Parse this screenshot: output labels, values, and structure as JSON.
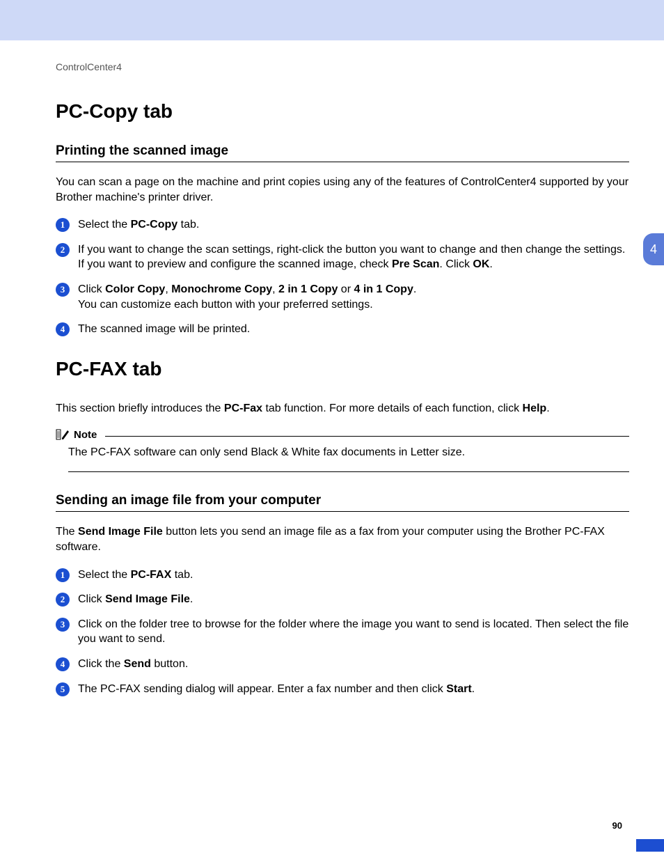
{
  "breadcrumb": "ControlCenter4",
  "side_tab_number": "4",
  "page_number": "90",
  "sections": {
    "pccopy": {
      "title": "PC-Copy tab",
      "sub1": {
        "title": "Printing the scanned image",
        "intro": "You can scan a page on the machine and print copies using any of the features of ControlCenter4 supported by your Brother machine's printer driver.",
        "steps": {
          "s1_a": "Select the ",
          "s1_b": "PC-Copy",
          "s1_c": " tab.",
          "s2_a": "If you want to change the scan settings, right-click the button you want to change and then change the settings. If you want to preview and configure the scanned image, check ",
          "s2_b": "Pre Scan",
          "s2_c": ". Click ",
          "s2_d": "OK",
          "s2_e": ".",
          "s3_a": "Click ",
          "s3_b": "Color Copy",
          "s3_c": ", ",
          "s3_d": "Monochrome Copy",
          "s3_e": ", ",
          "s3_f": "2 in 1 Copy",
          "s3_g": " or ",
          "s3_h": "4 in 1 Copy",
          "s3_i": ".",
          "s3_line2": "You can customize each button with your preferred settings.",
          "s4": "The scanned image will be printed."
        }
      }
    },
    "pcfax": {
      "title": "PC-FAX tab",
      "intro_a": "This section briefly introduces the ",
      "intro_b": "PC-Fax",
      "intro_c": " tab function. For more details of each function, click ",
      "intro_d": "Help",
      "intro_e": ".",
      "note_label": "Note",
      "note_body": "The PC-FAX software can only send Black & White fax documents in Letter size.",
      "sub1": {
        "title": "Sending an image file from your computer",
        "intro_a": "The ",
        "intro_b": "Send Image File",
        "intro_c": " button lets you send an image file as a fax from your computer using the Brother PC-FAX software.",
        "steps": {
          "s1_a": "Select the ",
          "s1_b": "PC-FAX",
          "s1_c": " tab.",
          "s2_a": "Click ",
          "s2_b": "Send Image File",
          "s2_c": ".",
          "s3": "Click on the folder tree to browse for the folder where the image you want to send is located. Then select the file you want to send.",
          "s4_a": "Click the ",
          "s4_b": "Send",
          "s4_c": " button.",
          "s5_a": "The PC-FAX sending dialog will appear. Enter a fax number and then click ",
          "s5_b": "Start",
          "s5_c": "."
        }
      }
    }
  }
}
